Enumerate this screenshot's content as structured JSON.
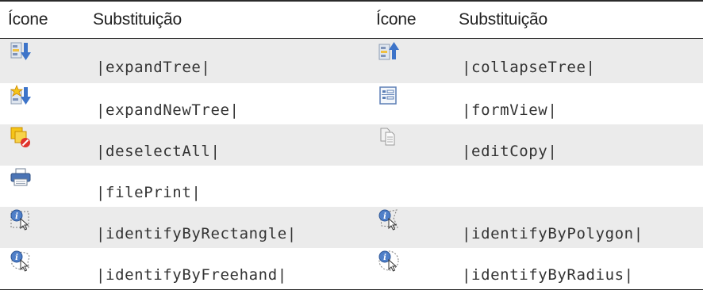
{
  "table": {
    "headers": [
      "Ícone",
      "Substituição",
      "Ícone",
      "Substituição"
    ],
    "rows": [
      [
        {
          "icon": "expand-tree-icon",
          "text": "|expandTree|"
        },
        {
          "icon": "collapse-tree-icon",
          "text": "|collapseTree|"
        }
      ],
      [
        {
          "icon": "expand-new-tree-icon",
          "text": "|expandNewTree|"
        },
        {
          "icon": "form-view-icon",
          "text": "|formView|"
        }
      ],
      [
        {
          "icon": "deselect-all-icon",
          "text": "|deselectAll|"
        },
        {
          "icon": "edit-copy-icon",
          "text": "|editCopy|"
        }
      ],
      [
        {
          "icon": "file-print-icon",
          "text": "|filePrint|"
        },
        {
          "icon": "",
          "text": ""
        }
      ],
      [
        {
          "icon": "identify-by-rectangle-icon",
          "text": "|identifyByRectangle|"
        },
        {
          "icon": "identify-by-polygon-icon",
          "text": "|identifyByPolygon|"
        }
      ],
      [
        {
          "icon": "identify-by-freehand-icon",
          "text": "|identifyByFreehand|"
        },
        {
          "icon": "identify-by-radius-icon",
          "text": "|identifyByRadius|"
        }
      ]
    ]
  }
}
